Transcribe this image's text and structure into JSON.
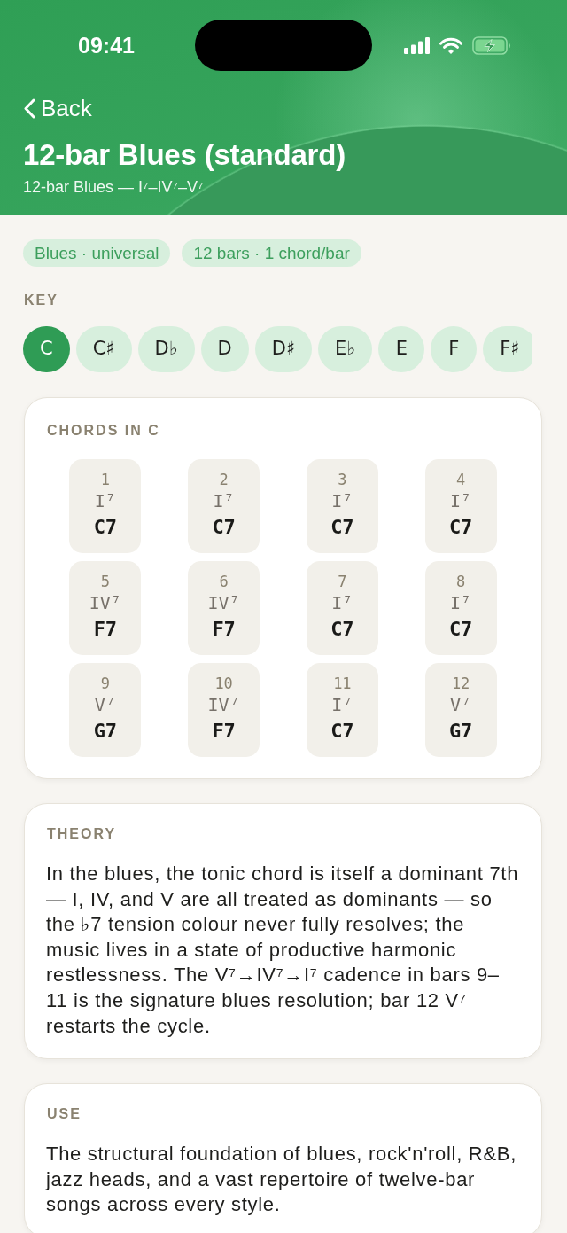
{
  "status_bar": {
    "time": "09:41"
  },
  "header": {
    "back_label": "Back",
    "title": "12-bar Blues (standard)",
    "subtitle": "12-bar Blues — I⁷–IV⁷–V⁷"
  },
  "tags": [
    "Blues · universal",
    "12 bars · 1 chord/bar"
  ],
  "key_picker": {
    "label": "KEY",
    "keys": [
      {
        "label": "C",
        "selected": true
      },
      {
        "label": "C♯",
        "selected": false
      },
      {
        "label": "D♭",
        "selected": false
      },
      {
        "label": "D",
        "selected": false
      },
      {
        "label": "D♯",
        "selected": false
      },
      {
        "label": "E♭",
        "selected": false
      },
      {
        "label": "E",
        "selected": false
      },
      {
        "label": "F",
        "selected": false
      },
      {
        "label": "F♯",
        "selected": false
      }
    ]
  },
  "chords": {
    "title": "CHORDS IN C",
    "bars": [
      {
        "number": "1",
        "numeral": "I⁷",
        "chord": "C7"
      },
      {
        "number": "2",
        "numeral": "I⁷",
        "chord": "C7"
      },
      {
        "number": "3",
        "numeral": "I⁷",
        "chord": "C7"
      },
      {
        "number": "4",
        "numeral": "I⁷",
        "chord": "C7"
      },
      {
        "number": "5",
        "numeral": "IV⁷",
        "chord": "F7"
      },
      {
        "number": "6",
        "numeral": "IV⁷",
        "chord": "F7"
      },
      {
        "number": "7",
        "numeral": "I⁷",
        "chord": "C7"
      },
      {
        "number": "8",
        "numeral": "I⁷",
        "chord": "C7"
      },
      {
        "number": "9",
        "numeral": "V⁷",
        "chord": "G7"
      },
      {
        "number": "10",
        "numeral": "IV⁷",
        "chord": "F7"
      },
      {
        "number": "11",
        "numeral": "I⁷",
        "chord": "C7"
      },
      {
        "number": "12",
        "numeral": "V⁷",
        "chord": "G7"
      }
    ]
  },
  "sections": [
    {
      "title": "THEORY",
      "text": "In the blues, the tonic chord is itself a dominant 7th — I, IV, and V are all treated as dominants — so the ♭7 tension colour never fully resolves; the music lives in a state of productive harmonic restlessness. The V⁷→IV⁷→I⁷ cadence in bars 9–11 is the signature blues resolution; bar 12 V⁷ restarts the cycle."
    },
    {
      "title": "USE",
      "text": "The structural foundation of blues, rock'n'roll, R&B, jazz heads, and a vast repertoire of twelve-bar songs across every style."
    }
  ]
}
